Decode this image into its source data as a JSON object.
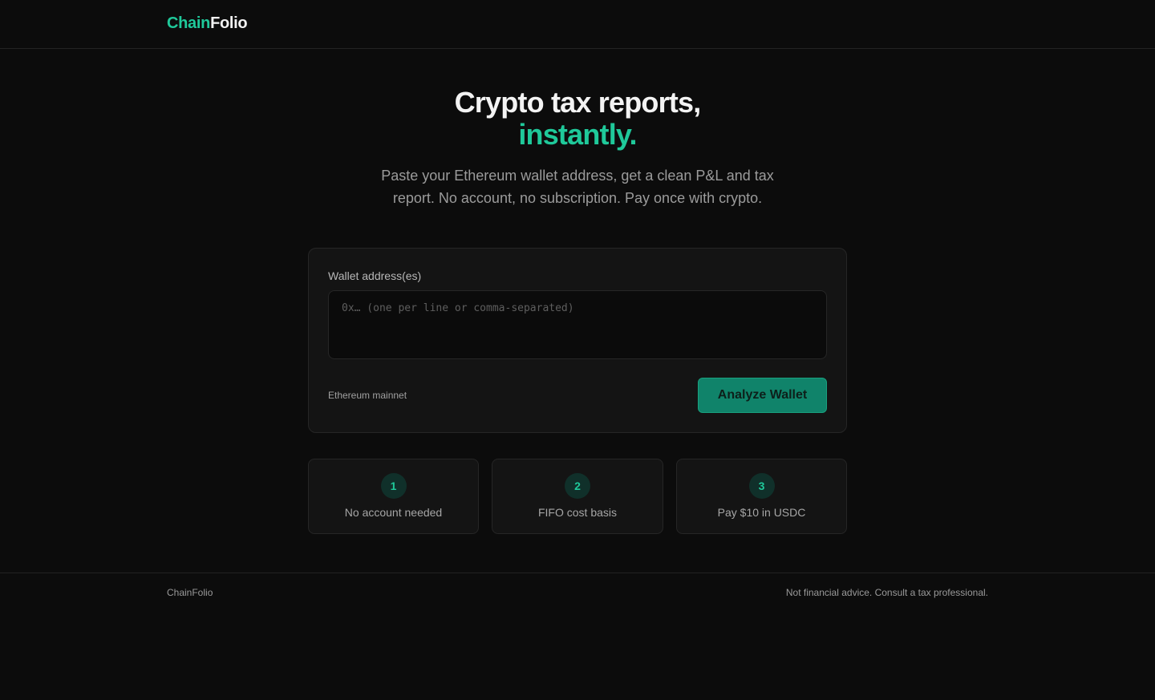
{
  "header": {
    "logo_part1": "Chain",
    "logo_part2": "Folio"
  },
  "hero": {
    "title_line1": "Crypto tax reports,",
    "title_line2": "instantly.",
    "subtitle": "Paste your Ethereum wallet address, get a clean P&L and tax report. No account, no subscription. Pay once with crypto."
  },
  "form": {
    "label": "Wallet address(es)",
    "input_value": "",
    "input_placeholder": "0x… (one per line or comma-separated)",
    "network": "Ethereum mainnet",
    "submit_label": "Analyze Wallet"
  },
  "steps": [
    {
      "number": "1",
      "label": "No account needed"
    },
    {
      "number": "2",
      "label": "FIFO cost basis"
    },
    {
      "number": "3",
      "label": "Pay $10 in USDC"
    }
  ],
  "footer": {
    "brand": "ChainFolio",
    "disclaimer": "Not financial advice. Consult a tax professional."
  },
  "colors": {
    "accent": "#1fc99a",
    "button": "#10836a",
    "background": "#0c0c0c"
  }
}
